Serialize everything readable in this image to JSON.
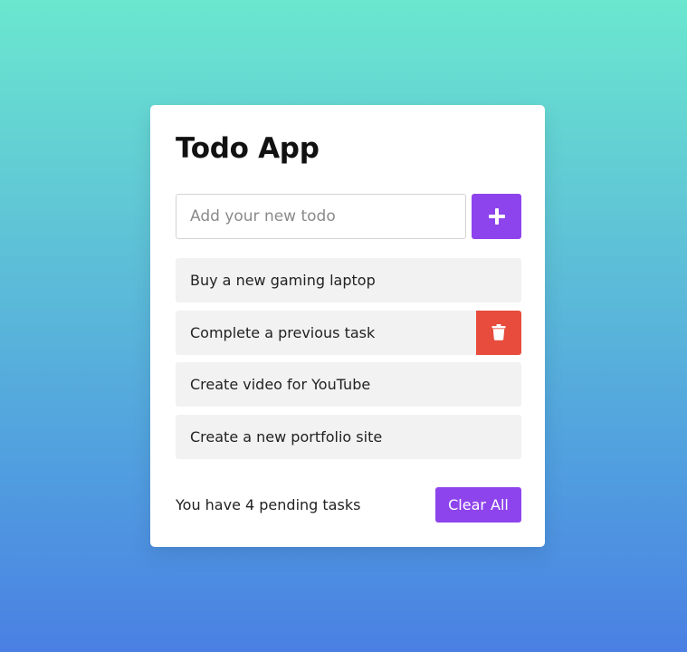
{
  "app": {
    "title": "Todo App"
  },
  "input": {
    "placeholder": "Add your new todo",
    "value": ""
  },
  "add_button": {
    "icon": "plus-icon"
  },
  "todos": [
    {
      "label": "Buy a new gaming laptop"
    },
    {
      "label": "Complete a previous task",
      "hovered": true,
      "delete_icon": "trash-icon"
    },
    {
      "label": "Create video for YouTube"
    },
    {
      "label": "Create a new portfolio site"
    }
  ],
  "footer": {
    "pending_text": "You have 4 pending tasks",
    "clear_label": "Clear All"
  },
  "colors": {
    "accent": "#8e44ec",
    "danger": "#e74c3c",
    "item_bg": "#f2f2f2",
    "gradient_top": "#6ae7cf",
    "gradient_bottom": "#4a80e3"
  }
}
